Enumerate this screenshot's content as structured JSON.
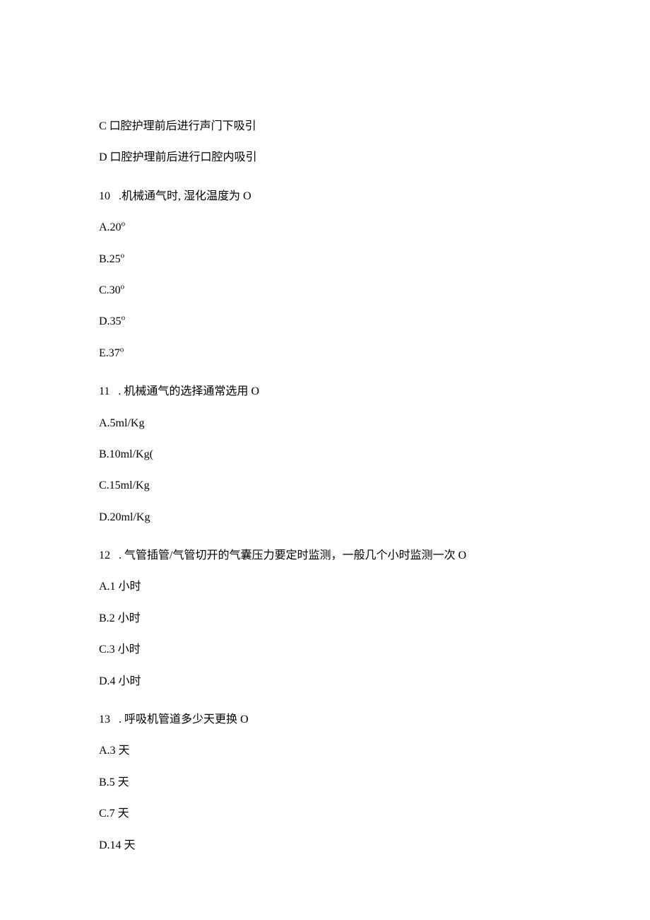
{
  "partialOptions": {
    "c": "C 口腔护理前后进行声门下吸引",
    "d": "D 口腔护理前后进行口腔内吸引"
  },
  "questions": [
    {
      "num": "10",
      "text": ".机械通气时, 湿化温度为 O",
      "options": [
        {
          "label": "A.20",
          "sup": "o"
        },
        {
          "label": "B.25",
          "sup": "o"
        },
        {
          "label": "C.30",
          "sup": "o"
        },
        {
          "label": "D.35",
          "sup": "o"
        },
        {
          "label": "E.37",
          "sup": "o"
        }
      ]
    },
    {
      "num": "11",
      "text": ". 机械通气的选择通常选用 O",
      "options": [
        {
          "label": "A.5ml/Kg"
        },
        {
          "label": "B.10ml/Kg("
        },
        {
          "label": "C.15ml/Kg"
        },
        {
          "label": "D.20ml/Kg"
        }
      ]
    },
    {
      "num": "12",
      "text": ". 气管插管/气管切开的气囊压力要定时监测，一般几个小时监测一次 O",
      "options": [
        {
          "label": "A.1 小时"
        },
        {
          "label": "B.2 小时"
        },
        {
          "label": "C.3 小时"
        },
        {
          "label": "D.4 小时"
        }
      ]
    },
    {
      "num": "13",
      "text": ". 呼吸机管道多少天更换 O",
      "options": [
        {
          "label": "A.3 天"
        },
        {
          "label": "B.5 天"
        },
        {
          "label": "C.7 天"
        },
        {
          "label": "D.14 天"
        }
      ]
    }
  ]
}
